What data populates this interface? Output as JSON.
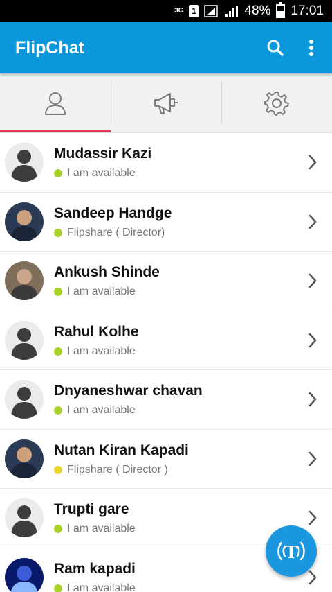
{
  "status_bar": {
    "network": "3G",
    "sim": "1",
    "battery_percent": "48%",
    "battery_level": 0.48,
    "time": "17:01"
  },
  "app_bar": {
    "title": "FlipChat",
    "actions": [
      "search-icon",
      "more-vert-icon"
    ],
    "color": "#0a97db"
  },
  "tabs": [
    {
      "icon": "person-icon",
      "selected": true
    },
    {
      "icon": "megaphone-icon",
      "selected": false
    },
    {
      "icon": "gear-icon",
      "selected": false
    }
  ],
  "tab_indicator_color": "#e8345b",
  "contacts": [
    {
      "name": "Mudassir Kazi",
      "status": "I am available",
      "status_color": "#a6d22a",
      "avatar": "default"
    },
    {
      "name": "Sandeep Handge",
      "status": "Flipshare ( Director)",
      "status_color": "#a6d22a",
      "avatar": "photo"
    },
    {
      "name": "Ankush Shinde",
      "status": "I am available",
      "status_color": "#a6d22a",
      "avatar": "photo"
    },
    {
      "name": "Rahul Kolhe",
      "status": "I am available",
      "status_color": "#a6d22a",
      "avatar": "default"
    },
    {
      "name": "Dnyaneshwar chavan",
      "status": "I am available",
      "status_color": "#a6d22a",
      "avatar": "default"
    },
    {
      "name": "Nutan Kiran Kapadi",
      "status": "Flipshare ( Director )",
      "status_color": "#e9d42b",
      "avatar": "photo"
    },
    {
      "name": "Trupti gare",
      "status": "I am available",
      "status_color": "#a6d22a",
      "avatar": "default"
    },
    {
      "name": "Ram kapadi",
      "status": "I am available",
      "status_color": "#a6d22a",
      "avatar": "photo"
    }
  ],
  "fab": {
    "icon": "broadcast-t-icon",
    "label": "T",
    "color": "#1b97e0"
  }
}
